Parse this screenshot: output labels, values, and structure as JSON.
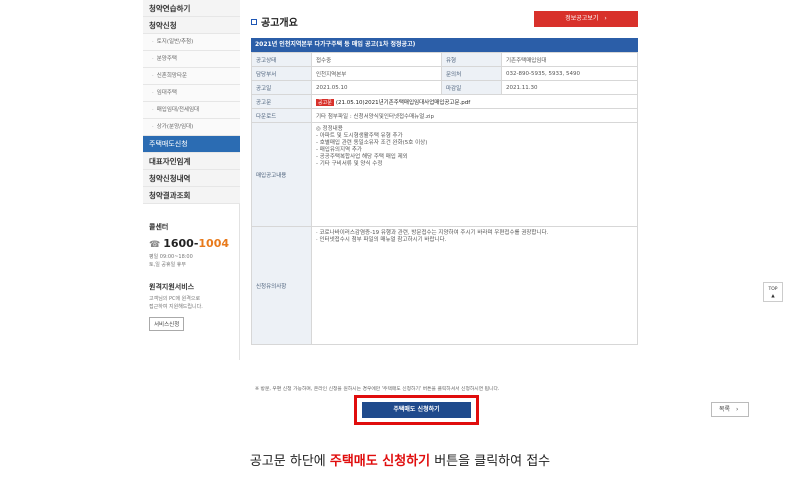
{
  "sidebar": {
    "top_items": [
      {
        "label": "청약연습하기",
        "kind": "head"
      },
      {
        "label": "청약신청",
        "kind": "head"
      },
      {
        "label": "토지(일반/추첨)",
        "kind": "sub"
      },
      {
        "label": "분양주택",
        "kind": "sub"
      },
      {
        "label": "신혼희망타운",
        "kind": "sub"
      },
      {
        "label": "임대주택",
        "kind": "sub"
      },
      {
        "label": "매입임대/전세임대",
        "kind": "sub"
      },
      {
        "label": "상가(분양/임대)",
        "kind": "sub"
      },
      {
        "label": "주택매도신청",
        "kind": "active"
      },
      {
        "label": "대표자인임계",
        "kind": "big"
      },
      {
        "label": "청약신청내역",
        "kind": "big"
      },
      {
        "label": "청약결과조회",
        "kind": "big"
      }
    ],
    "callcenter": {
      "title": "콜센터",
      "number_prefix": "1600-",
      "number_suffix": "1004",
      "hours_line1": "평일 09:00~18:00",
      "hours_line2": "토,일 공휴일 휴무"
    },
    "remote": {
      "title": "원격지원서비스",
      "desc_line1": "고객님의 PC에 원격으로",
      "desc_line2": "접근하여 지원해드립니다.",
      "button": "서비스신청"
    }
  },
  "content": {
    "section_title": "공고개요",
    "summary_button": "정보공고보기",
    "notice_title": "2021년 인천지역본부 다가구주택 등 매입 공고(1차 정정공고)",
    "rows": {
      "status_label": "공고상태",
      "status_value": "접수중",
      "type_label": "유형",
      "type_value": "기존주택매입임대",
      "dept_label": "담당부서",
      "dept_value": "인천지역본부",
      "contact_label": "문의처",
      "contact_value": "032-890-5935, 5933, 5490",
      "notice_date_label": "공고일",
      "notice_date_value": "2021.05.10",
      "deadline_label": "마감일",
      "deadline_value": "2021.11.30",
      "doc_label": "공고문",
      "doc_tag": "공고문",
      "doc_file": "(21.05.10)2021년기존주택매입임대사업매입공고문.pdf",
      "download_label": "다운로드",
      "download_value": "기타 첨부파일 : 신청서양식및인터넷접수매뉴얼.zip",
      "content_label": "매입공고내용",
      "content_lines": [
        "◎ 정정내용",
        "- 아파트 및 도시형생활주택 유형 추가",
        "- 호별매입 관련 동일소유자 조건 완화(5호 이상)",
        "- 매입유의지역 추가",
        "- 공공주택복합사업 해당 주택 매입 제외",
        "- 기타 구비서류 및 양식 수정"
      ],
      "caution_label": "신청유의사항",
      "caution_lines": [
        "· 코로나바이러스감염증-19 유행과 관련, 방문접수는 지양하여 주시기 바라며 우편접수를 권장합니다.",
        "· 인터넷접수시 첨부 파일의 매뉴얼 참고하시기 바랍니다."
      ]
    },
    "footnote": "※ 방문, 우편 신청 가능하며, 온라인 신청을 원하시는 경우에만 '주택매도 신청하기' 버튼을 클릭하셔서 신청하시면 됩니다.",
    "apply_button": "주택매도 신청하기",
    "list_button": "목록"
  },
  "top_button": "TOP",
  "caption": {
    "prefix": "공고문 하단에 ",
    "highlight": "주택매도 신청하기",
    "suffix": " 버튼을 클릭하여 접수"
  }
}
